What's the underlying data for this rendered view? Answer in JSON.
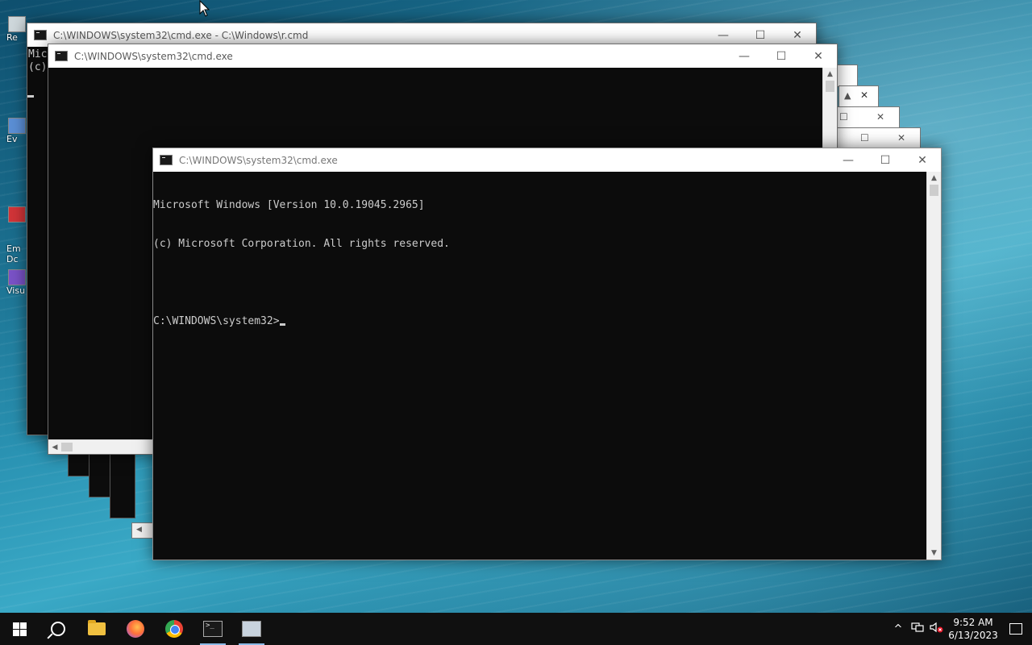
{
  "desktop": {
    "icons": [
      {
        "label": "Re"
      },
      {
        "label": "Ev"
      },
      {
        "label": "Em\nDc"
      },
      {
        "label": "Visu"
      }
    ]
  },
  "windows": {
    "back": {
      "title": "C:\\WINDOWS\\system32\\cmd.exe - C:\\Windows\\r.cmd",
      "console": "Mic\n(c)"
    },
    "middle": {
      "title": "C:\\WINDOWS\\system32\\cmd.exe"
    },
    "front": {
      "title": "C:\\WINDOWS\\system32\\cmd.exe",
      "line1": "Microsoft Windows [Version 10.0.19045.2965]",
      "line2": "(c) Microsoft Corporation. All rights reserved.",
      "prompt": "C:\\WINDOWS\\system32>"
    }
  },
  "caption_buttons": {
    "minimize": "—",
    "maximize": "☐",
    "close": "✕"
  },
  "scroll_arrows": {
    "up": "▲",
    "down": "▼",
    "left": "◀"
  },
  "taskbar": {
    "apps": [
      "start",
      "search",
      "file-explorer",
      "firefox",
      "chrome",
      "cmd",
      "remote-desktop"
    ]
  },
  "tray": {
    "chevron": "^",
    "time": "9:52 AM",
    "date": "6/13/2023"
  }
}
